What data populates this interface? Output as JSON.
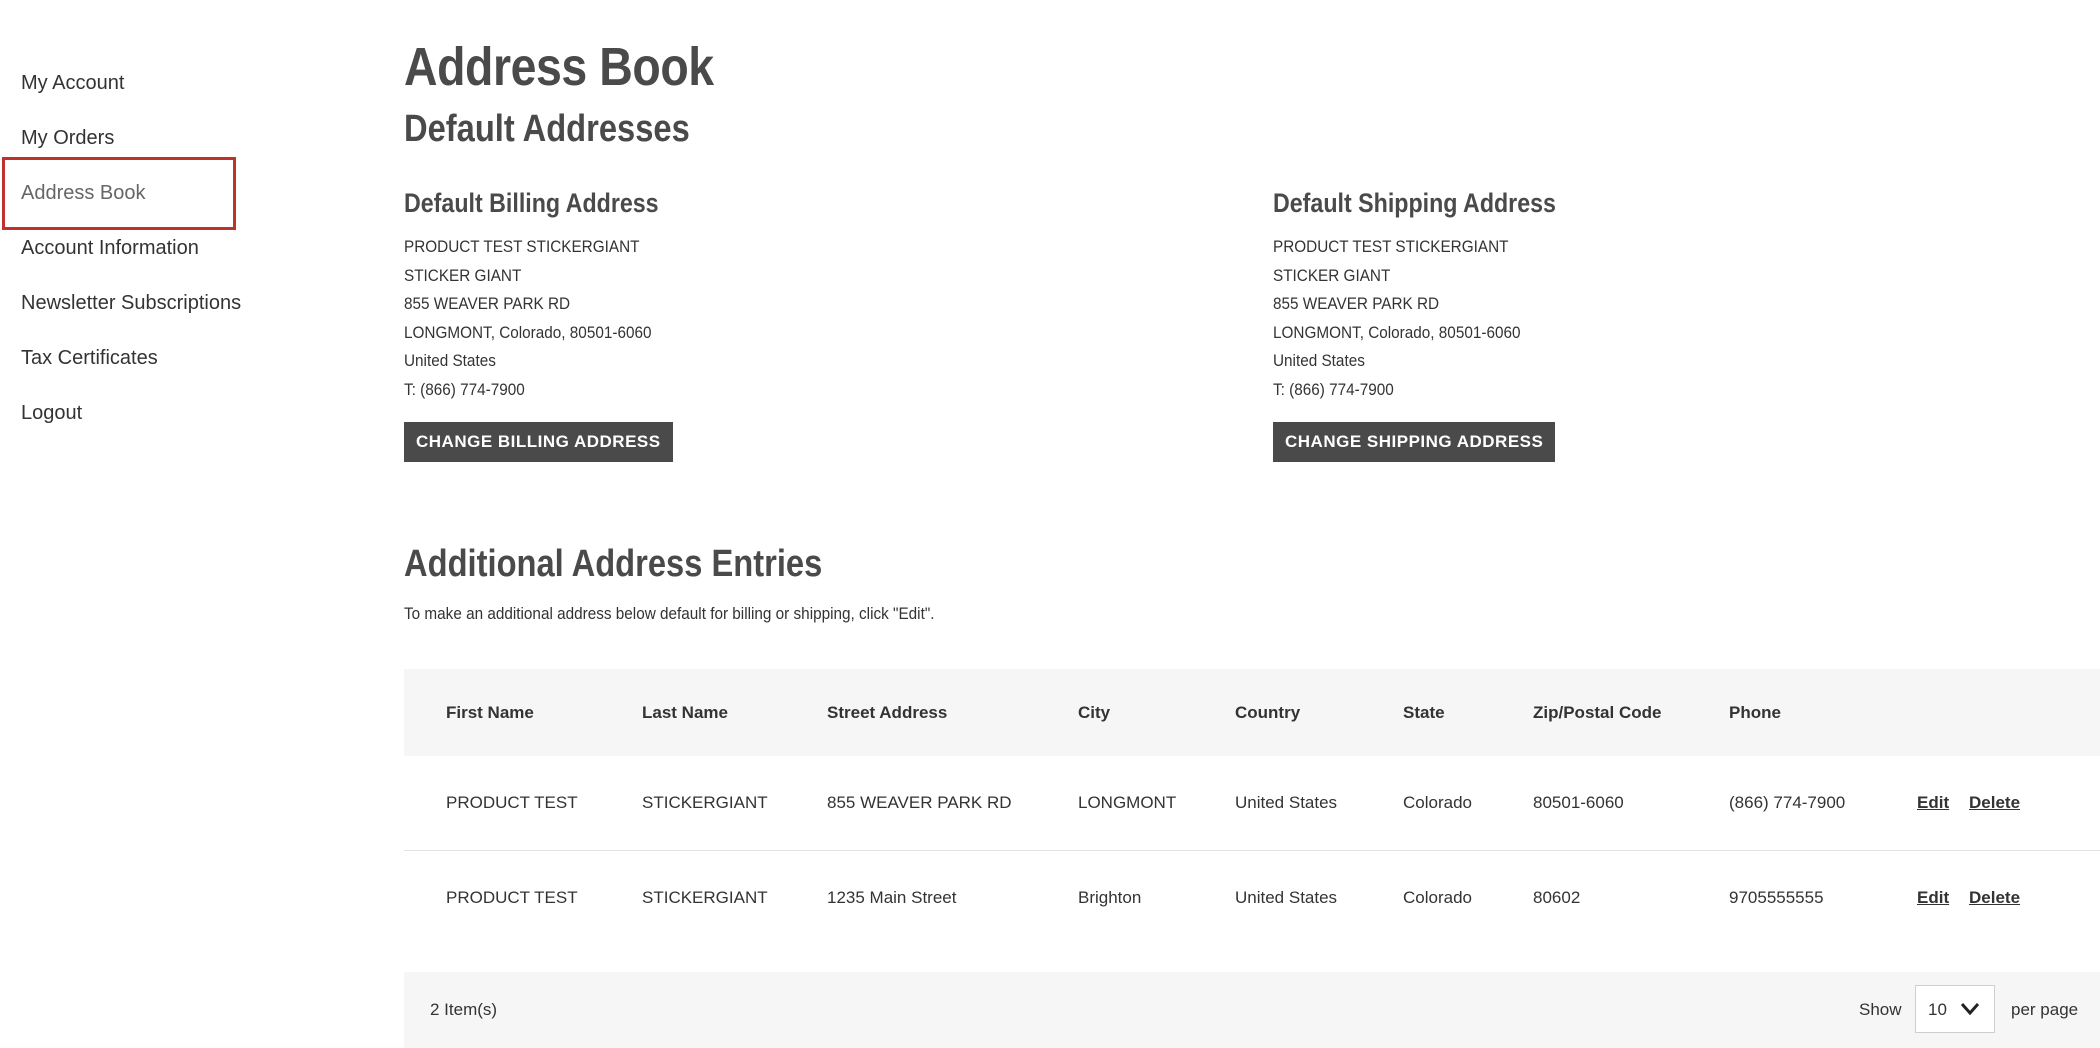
{
  "sidebar": {
    "items": [
      {
        "label": "My Account"
      },
      {
        "label": "My Orders"
      },
      {
        "label": "Address Book"
      },
      {
        "label": "Account Information"
      },
      {
        "label": "Newsletter Subscriptions"
      },
      {
        "label": "Tax Certificates"
      },
      {
        "label": "Logout"
      }
    ]
  },
  "main": {
    "title": "Address Book",
    "default_section_title": "Default Addresses",
    "billing": {
      "heading": "Default Billing Address",
      "lines": [
        "PRODUCT TEST STICKERGIANT",
        "STICKER GIANT",
        "855 WEAVER PARK RD",
        "LONGMONT, Colorado, 80501-6060",
        "United States",
        "T: (866) 774-7900"
      ],
      "button": "CHANGE BILLING ADDRESS"
    },
    "shipping": {
      "heading": "Default Shipping Address",
      "lines": [
        "PRODUCT TEST STICKERGIANT",
        "STICKER GIANT",
        "855 WEAVER PARK RD",
        "LONGMONT, Colorado, 80501-6060",
        "United States",
        "T: (866) 774-7900"
      ],
      "button": "CHANGE SHIPPING ADDRESS"
    },
    "additional_title": "Additional Address Entries",
    "additional_note": "To make an additional address below default for billing or shipping, click \"Edit\"."
  },
  "table": {
    "headers": [
      "First Name",
      "Last Name",
      "Street Address",
      "City",
      "Country",
      "State",
      "Zip/Postal Code",
      "Phone"
    ],
    "rows": [
      {
        "first": "PRODUCT TEST",
        "last": "STICKERGIANT",
        "street": "855 WEAVER PARK RD",
        "city": "LONGMONT",
        "country": "United States",
        "state": "Colorado",
        "zip": "80501-6060",
        "phone": "(866) 774-7900",
        "edit": "Edit",
        "delete": "Delete"
      },
      {
        "first": "PRODUCT TEST",
        "last": "STICKERGIANT",
        "street": "1235 Main Street",
        "city": "Brighton",
        "country": "United States",
        "state": "Colorado",
        "zip": "80602",
        "phone": "9705555555",
        "edit": "Edit",
        "delete": "Delete"
      }
    ]
  },
  "footer": {
    "items_count": "2 Item(s)",
    "show_label": "Show",
    "per_page_value": "10",
    "per_page_label": "per page"
  },
  "colors": {
    "accent_highlight": "#c0312b",
    "button_bg": "#4a4a4a",
    "table_bg": "#f6f6f6"
  }
}
